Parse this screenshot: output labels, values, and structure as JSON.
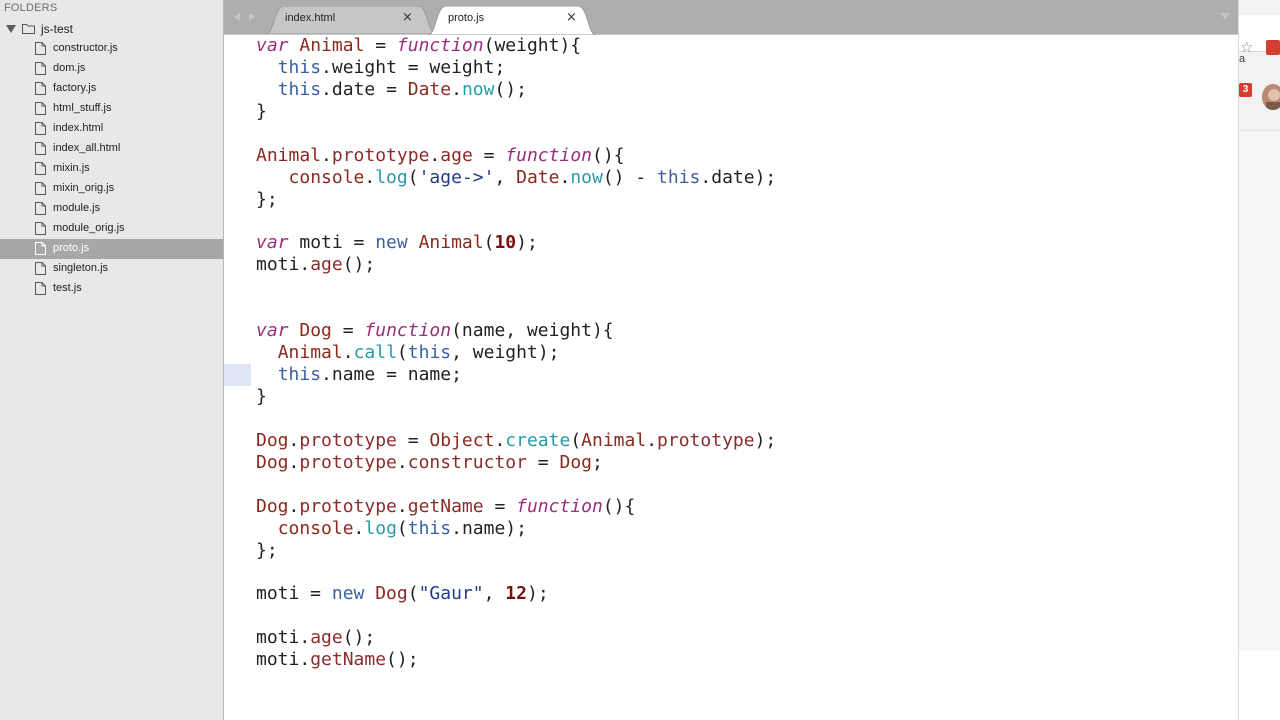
{
  "sidebar": {
    "header": "FOLDERS",
    "root_folder": "js-test",
    "files": [
      {
        "name": "constructor.js",
        "selected": false
      },
      {
        "name": "dom.js",
        "selected": false
      },
      {
        "name": "factory.js",
        "selected": false
      },
      {
        "name": "html_stuff.js",
        "selected": false
      },
      {
        "name": "index.html",
        "selected": false
      },
      {
        "name": "index_all.html",
        "selected": false
      },
      {
        "name": "mixin.js",
        "selected": false
      },
      {
        "name": "mixin_orig.js",
        "selected": false
      },
      {
        "name": "module.js",
        "selected": false
      },
      {
        "name": "module_orig.js",
        "selected": false
      },
      {
        "name": "proto.js",
        "selected": true
      },
      {
        "name": "singleton.js",
        "selected": false
      },
      {
        "name": "test.js",
        "selected": false
      }
    ]
  },
  "tabs": [
    {
      "label": "index.html",
      "active": false,
      "close": "×"
    },
    {
      "label": "proto.js",
      "active": true,
      "close": "×"
    }
  ],
  "code_lines": [
    "var Animal = function(weight){",
    "  this.weight = weight;",
    "  this.date = Date.now();",
    "}",
    "",
    "Animal.prototype.age = function(){",
    "   console.log('age->', Date.now() - this.date);",
    "};",
    "",
    "var moti = new Animal(10);",
    "moti.age();",
    "",
    "",
    "var Dog = function(name, weight){",
    "  Animal.call(this, weight);",
    "  this.name = name;",
    "}",
    "",
    "Dog.prototype = Object.create(Animal.prototype);",
    "Dog.prototype.constructor = Dog;",
    "",
    "Dog.prototype.getName = function(){",
    "  console.log(this.name);",
    "};",
    "",
    "moti = new Dog(\"Gaur\", 12);",
    "",
    "moti.age();",
    "moti.getName();"
  ],
  "browser": {
    "search_fragment": "a",
    "notification_count": "3",
    "icons": [
      "star-icon",
      "extension-icon",
      "avatar"
    ]
  },
  "colors": {
    "keyword": "#9a2f7b",
    "type": "#8a2a1f",
    "function_call": "#2a9aa7",
    "number": "#7a1010",
    "string": "#223a8a",
    "selection": "#a7a7a7"
  }
}
